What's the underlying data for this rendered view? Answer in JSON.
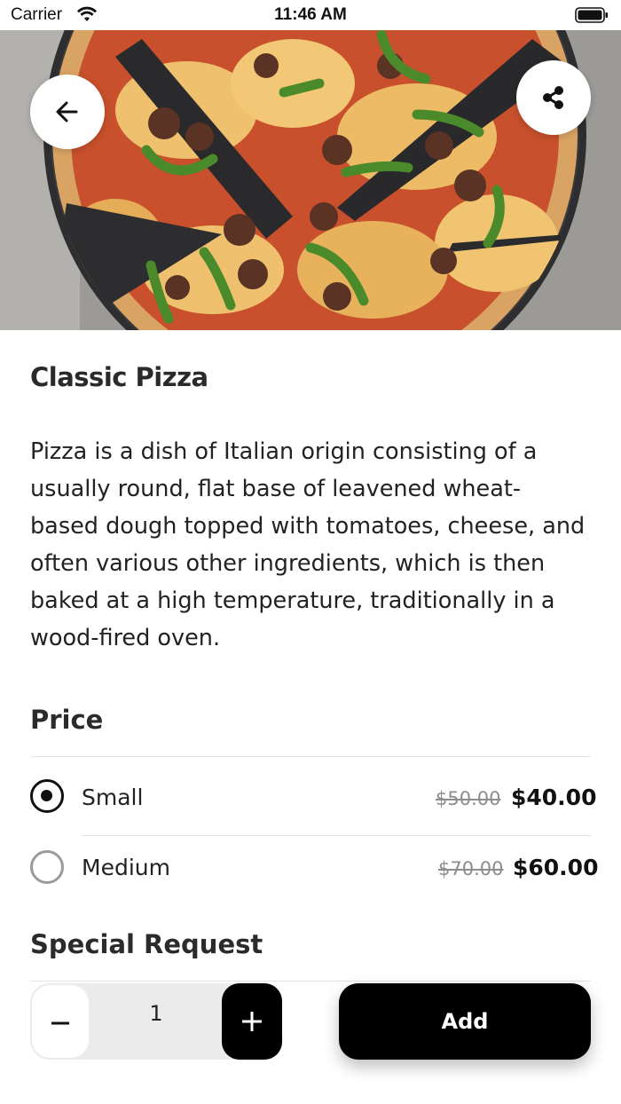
{
  "status_bar": {
    "carrier": "Carrier",
    "time": "11:46 AM",
    "wifi_icon": "wifi-icon",
    "battery_icon": "battery-icon"
  },
  "hero": {
    "image": "pizza-photo",
    "back_icon": "arrow-left-icon",
    "share_icon": "share-icon"
  },
  "product": {
    "title": "Classic Pizza",
    "description": "Pizza is a dish of Italian origin consisting of a usually round, flat base of leavened wheat-based dough topped with tomatoes, cheese, and often various other ingredients, which is then baked at a high temperature, traditionally in a wood-fired oven."
  },
  "price": {
    "heading": "Price",
    "options": [
      {
        "label": "Small",
        "old_price": "$50.00",
        "price": "$40.00",
        "selected": true
      },
      {
        "label": "Medium",
        "old_price": "$70.00",
        "price": "$60.00",
        "selected": false
      }
    ]
  },
  "special_request": {
    "heading": "Special Request"
  },
  "cart": {
    "minus_icon": "minus-icon",
    "quantity": "1",
    "plus_icon": "plus-icon",
    "add_label": "Add"
  },
  "colors": {
    "primary": "#000000",
    "text": "#222222",
    "muted": "#8d8d8d",
    "stepper_bg": "#ebebeb"
  }
}
